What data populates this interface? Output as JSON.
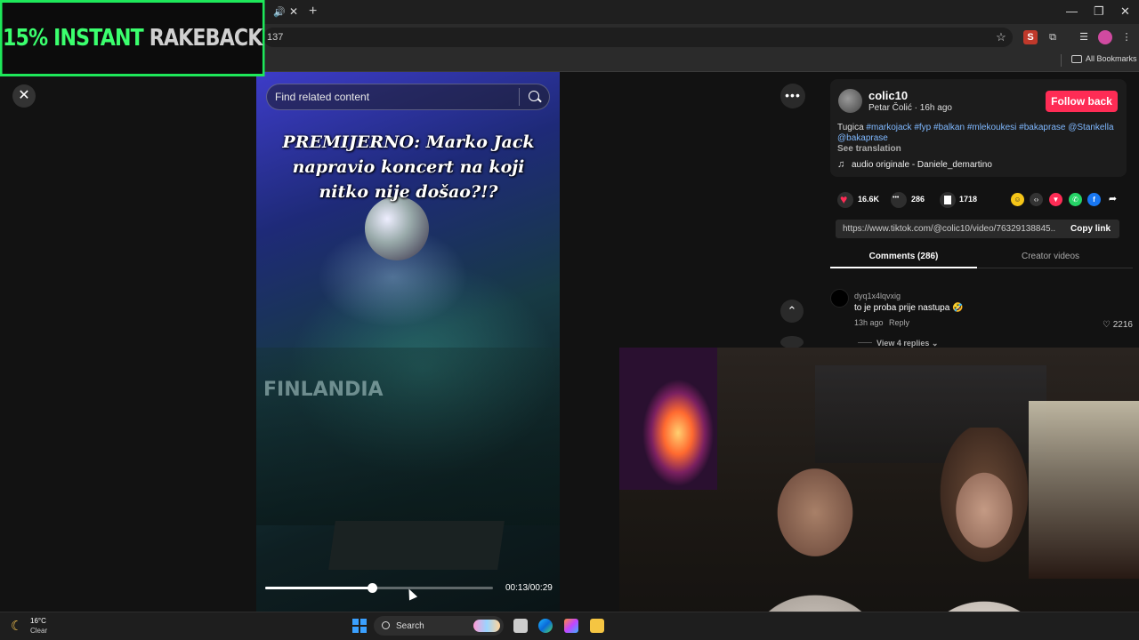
{
  "overlay": {
    "promo_green": "15% INSTANT",
    "promo_gray": "RAKEBACK"
  },
  "browser": {
    "url_fragment": "137",
    "bookmarks_label": "All Bookmarks",
    "window_controls": [
      "—",
      "❐",
      "✕"
    ]
  },
  "video": {
    "search_placeholder": "Find related content",
    "title": "PREMIJERNO: Marko Jack napravio koncert na koji nitko nije došao?!?",
    "venue_sign": "FINLANDIA",
    "time": "00:13/00:29",
    "progress": 0.47
  },
  "post": {
    "username": "colic10",
    "subline": "Petar Čolić · 16h ago",
    "follow_label": "Follow back",
    "caption_plain": "Tugica ",
    "caption_tags": "#markojack #fyp #balkan #mlekoukesi #bakaprase @Stankella @bakaprase",
    "see_translation": "See translation",
    "music": "audio originale - Daniele_demartino",
    "likes": "16.6K",
    "comments": "286",
    "saves": "1718",
    "link": "https://www.tiktok.com/@colic10/video/76329138845...",
    "copy_link_label": "Copy link"
  },
  "tabs": {
    "comments": "Comments (286)",
    "creator_videos": "Creator videos"
  },
  "comment": {
    "user": "dyq1x4lqvxig",
    "text": "to je proba prije nastupa 🤣",
    "time": "13h ago",
    "reply_label": "Reply",
    "likes": "2216",
    "view_replies": "View 4 replies"
  },
  "taskbar": {
    "temperature": "16°C",
    "weather": "Clear",
    "search_label": "Search"
  },
  "colors": {
    "follow": "#fe2c55",
    "promo_border": "#1ee85a",
    "tag": "#7fb8ff"
  }
}
